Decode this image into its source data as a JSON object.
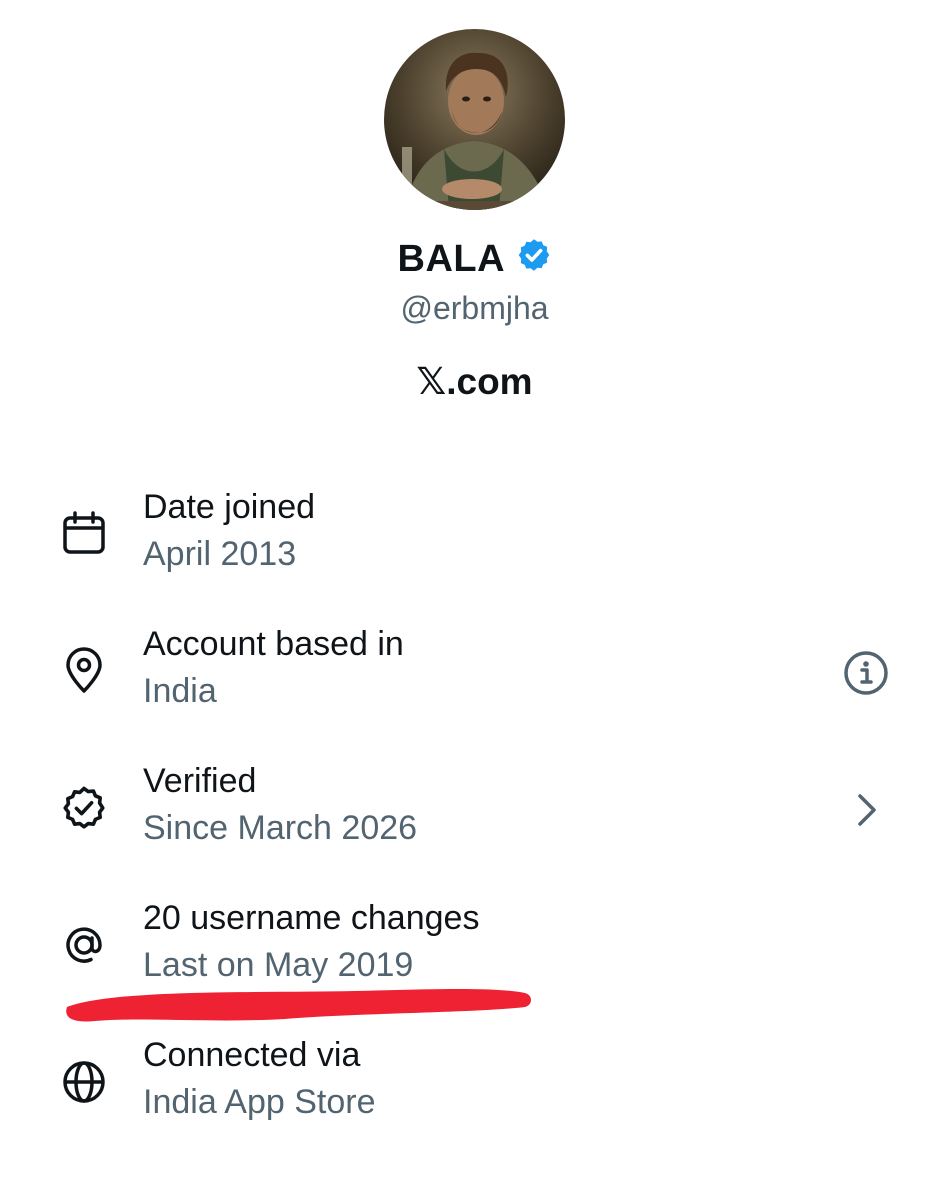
{
  "profile": {
    "name": "BALA",
    "handle": "@erbmjha",
    "platform": "𝕏.com",
    "badge_color": "#1d9bf0",
    "avatar": "profile-photo"
  },
  "about_rows": [
    {
      "icon": "calendar-icon",
      "title": "Date joined",
      "value": "April 2013"
    },
    {
      "icon": "location-pin-icon",
      "title": "Account based in",
      "value": "India",
      "action_icon": "info-icon"
    },
    {
      "icon": "verified-badge-icon",
      "title": "Verified",
      "value": "Since March 2026",
      "action_icon": "chevron-right-icon"
    },
    {
      "icon": "at-sign-icon",
      "title": "20 username changes",
      "value": "Last on May 2019"
    },
    {
      "icon": "globe-icon",
      "title": "Connected via",
      "value": "India App Store"
    }
  ],
  "annotation": {
    "type": "red-underline-stroke",
    "color": "#ee2233"
  },
  "colors": {
    "primary_text": "#0f1419",
    "secondary_text": "#536471",
    "background": "#ffffff"
  }
}
